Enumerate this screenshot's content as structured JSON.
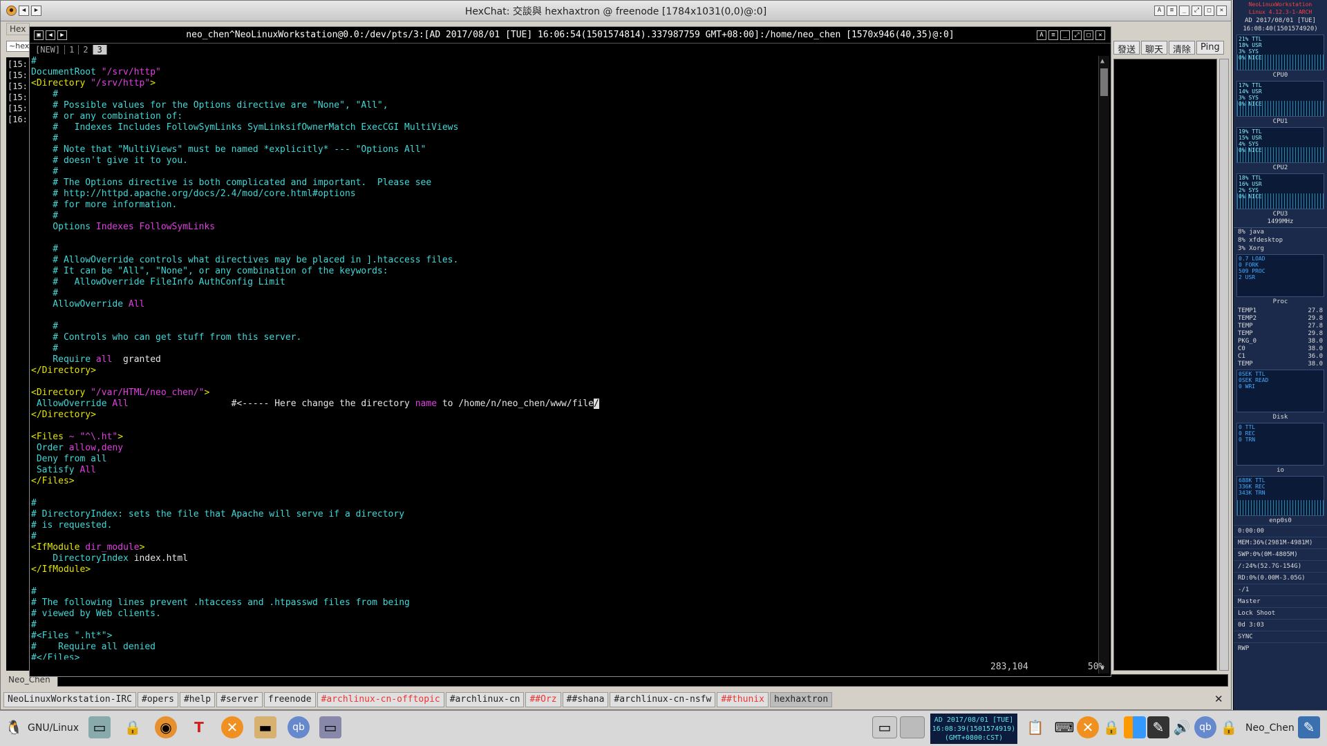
{
  "hexchat": {
    "title": "HexChat: 交談與 hexhaxtron @ freenode [1784x1031(0,0)@:0]",
    "menu_label": "Hex",
    "channel_label": "~hex",
    "left_lines": [
      "[15:",
      "[15:",
      "[15:",
      "[15:",
      "[15:",
      "[16:"
    ],
    "buttons": [
      "發送",
      "聊天",
      "清除",
      "Ping"
    ],
    "nick": "Neo_Chen",
    "tabs": [
      {
        "label": "NeoLinuxWorkstation-IRC",
        "red": false,
        "selected": false
      },
      {
        "label": "#opers",
        "red": false,
        "selected": false
      },
      {
        "label": "#help",
        "red": false,
        "selected": false
      },
      {
        "label": "#server",
        "red": false,
        "selected": false
      },
      {
        "label": "freenode",
        "red": false,
        "selected": false
      },
      {
        "label": "#archlinux-cn-offtopic",
        "red": true,
        "selected": false
      },
      {
        "label": "#archlinux-cn",
        "red": false,
        "selected": false
      },
      {
        "label": "##Orz",
        "red": true,
        "selected": false
      },
      {
        "label": "##shana",
        "red": false,
        "selected": false
      },
      {
        "label": "#archlinux-cn-nsfw",
        "red": false,
        "selected": false
      },
      {
        "label": "##thunix",
        "red": true,
        "selected": false
      },
      {
        "label": "hexhaxtron",
        "red": false,
        "selected": true
      }
    ],
    "close_glyph": "✕"
  },
  "terminal": {
    "title": "neo_chen^NeoLinuxWorkstation@0.0:/dev/pts/3:[AD 2017/08/01 [TUE] 16:06:54(1501574814).337987759 GMT+08:00]:/home/neo_chen [1570x946(40,35)@:0]",
    "tabs": [
      "[NEW]",
      "1",
      "2",
      "3"
    ],
    "active_tab": 3,
    "status_position": "283,104",
    "status_percent": "50%",
    "lines": [
      [
        [
          "cmt",
          "#"
        ]
      ],
      [
        [
          "cy",
          "DocumentRoot "
        ],
        [
          "mg",
          "\"/srv/http\""
        ]
      ],
      [
        [
          "yl",
          "<Directory "
        ],
        [
          "mg",
          "\"/srv/http\""
        ],
        [
          "yl",
          ">"
        ]
      ],
      [
        [
          "cmt",
          "    #"
        ]
      ],
      [
        [
          "cmt",
          "    # Possible values for the Options directive are \"None\", \"All\","
        ]
      ],
      [
        [
          "cmt",
          "    # or any combination of:"
        ]
      ],
      [
        [
          "cmt",
          "    #   Indexes Includes FollowSymLinks SymLinksifOwnerMatch ExecCGI MultiViews"
        ]
      ],
      [
        [
          "cmt",
          "    #"
        ]
      ],
      [
        [
          "cmt",
          "    # Note that \"MultiViews\" must be named *explicitly* --- \"Options All\""
        ]
      ],
      [
        [
          "cmt",
          "    # doesn't give it to you."
        ]
      ],
      [
        [
          "cmt",
          "    #"
        ]
      ],
      [
        [
          "cmt",
          "    # The Options directive is both complicated and important.  Please see"
        ]
      ],
      [
        [
          "cmt",
          "    # http://httpd.apache.org/docs/2.4/mod/core.html#options"
        ]
      ],
      [
        [
          "cmt",
          "    # for more information."
        ]
      ],
      [
        [
          "cmt",
          "    #"
        ]
      ],
      [
        [
          "cy",
          "    Options "
        ],
        [
          "mg",
          "Indexes FollowSymLinks"
        ]
      ],
      [
        [
          "",
          ""
        ]
      ],
      [
        [
          "cmt",
          "    #"
        ]
      ],
      [
        [
          "cmt",
          "    # AllowOverride controls what directives may be placed in ].htaccess files."
        ]
      ],
      [
        [
          "cmt",
          "    # It can be \"All\", \"None\", or any combination of the keywords:"
        ]
      ],
      [
        [
          "cmt",
          "    #   AllowOverride FileInfo AuthConfig Limit"
        ]
      ],
      [
        [
          "cmt",
          "    #"
        ]
      ],
      [
        [
          "cy",
          "    AllowOverride "
        ],
        [
          "mg",
          "All"
        ]
      ],
      [
        [
          "",
          ""
        ]
      ],
      [
        [
          "cmt",
          "    #"
        ]
      ],
      [
        [
          "cmt",
          "    # Controls who can get stuff from this server."
        ]
      ],
      [
        [
          "cmt",
          "    #"
        ]
      ],
      [
        [
          "cy",
          "    Require "
        ],
        [
          "mg",
          "all"
        ],
        [
          "",
          "  granted"
        ]
      ],
      [
        [
          "yl",
          "</Directory>"
        ]
      ],
      [
        [
          "",
          ""
        ]
      ],
      [
        [
          "yl",
          "<Directory "
        ],
        [
          "mg",
          "\"/var/HTML/neo_chen/\""
        ],
        [
          "yl",
          ">"
        ]
      ],
      [
        [
          "cy",
          " AllowOverride "
        ],
        [
          "mg",
          "All"
        ],
        [
          "",
          "                   #<----- Here change the directory "
        ],
        [
          "mg",
          "name"
        ],
        [
          "",
          " to /home/n/neo_chen/www/file"
        ],
        [
          "cursor",
          "/"
        ]
      ],
      [
        [
          "yl",
          "</Directory>"
        ]
      ],
      [
        [
          "",
          ""
        ]
      ],
      [
        [
          "yl",
          "<Files "
        ],
        [
          "mg",
          "~ \"^\\.ht\""
        ],
        [
          "yl",
          ">"
        ]
      ],
      [
        [
          "cy",
          " Order "
        ],
        [
          "mg",
          "allow,deny"
        ]
      ],
      [
        [
          "cy",
          " Deny from all"
        ]
      ],
      [
        [
          "cy",
          " Satisfy "
        ],
        [
          "mg",
          "All"
        ]
      ],
      [
        [
          "yl",
          "</Files>"
        ]
      ],
      [
        [
          "",
          ""
        ]
      ],
      [
        [
          "cmt",
          "#"
        ]
      ],
      [
        [
          "cmt",
          "# DirectoryIndex: sets the file that Apache will serve if a directory"
        ]
      ],
      [
        [
          "cmt",
          "# is requested."
        ]
      ],
      [
        [
          "cmt",
          "#"
        ]
      ],
      [
        [
          "yl",
          "<IfModule "
        ],
        [
          "mg",
          "dir_module"
        ],
        [
          "yl",
          ">"
        ]
      ],
      [
        [
          "cy",
          "    DirectoryIndex "
        ],
        [
          "",
          "index.html"
        ]
      ],
      [
        [
          "yl",
          "</IfModule>"
        ]
      ],
      [
        [
          "",
          ""
        ]
      ],
      [
        [
          "cmt",
          "#"
        ]
      ],
      [
        [
          "cmt",
          "# The following lines prevent .htaccess and .htpasswd files from being"
        ]
      ],
      [
        [
          "cmt",
          "# viewed by Web clients."
        ]
      ],
      [
        [
          "cmt",
          "#"
        ]
      ],
      [
        [
          "cmt",
          "#<Files \".ht*\">"
        ]
      ],
      [
        [
          "cmt",
          "#    Require all denied"
        ]
      ],
      [
        [
          "cmt",
          "#</Files>"
        ]
      ]
    ]
  },
  "sidebar": {
    "title_lines": [
      "NeoLinuxWorkstation",
      "Linux 4.12.3-1-ARCH"
    ],
    "date": "AD 2017/08/01 [TUE]",
    "time": "16:08:40(1501574920)",
    "cpus": [
      {
        "label": "CPU0",
        "stats": [
          "21% TTL",
          "18% USR",
          "3% SYS",
          "0% NICE"
        ]
      },
      {
        "label": "CPU1",
        "stats": [
          "17% TTL",
          "14% USR",
          "3% SYS",
          "0% NICE"
        ]
      },
      {
        "label": "CPU2",
        "stats": [
          "19% TTL",
          "15% USR",
          "4% SYS",
          "0% NICE"
        ]
      },
      {
        "label": "CPU3",
        "stats": [
          "18% TTL",
          "16% USR",
          "2% SYS",
          "0% NICE"
        ]
      }
    ],
    "freq": "1499MHz",
    "procs": [
      "8% java",
      "8% xfdesktop",
      "3% Xorg"
    ],
    "load": [
      "0.7 LOAD",
      "0 FORK",
      "509 PROC",
      "2 USR"
    ],
    "proc_label": "Proc",
    "temps": [
      [
        "TEMP1",
        "27.8"
      ],
      [
        "TEMP2",
        "29.8"
      ],
      [
        "TEMP",
        "27.8"
      ],
      [
        "TEMP",
        "29.8"
      ],
      [
        "PKG_0",
        "38.0"
      ],
      [
        "C0",
        "38.0"
      ],
      [
        "C1",
        "36.0"
      ],
      [
        "TEMP",
        "38.0"
      ]
    ],
    "disk": [
      "0SEK TTL",
      "0SEK READ",
      "0 WRI"
    ],
    "disk_label": "Disk",
    "io": [
      "0 TTL",
      "0 REC",
      "0 TRN"
    ],
    "io_label": "io",
    "net": [
      "688K TTL",
      "336K REC",
      "343K TRN"
    ],
    "net_label": "enp0s0",
    "bottom_lines": [
      "0:00:00",
      "MEM:36%(2981M-4981M)",
      "SWP:0%(0M-4805M)",
      "/:24%(52.7G-154G)",
      "RD:0%(0.00M-3.05G)",
      "-/1",
      "Master",
      "Lock Shoot",
      "0d 3:03",
      "SYNC",
      "RWP"
    ]
  },
  "taskbar": {
    "os_label": "GNU/Linux",
    "clock": [
      "AD 2017/08/01 [TUE]",
      "16:08:39(1501574919)",
      "(GMT+0800:CST)"
    ],
    "user": "Neo_Chen"
  }
}
